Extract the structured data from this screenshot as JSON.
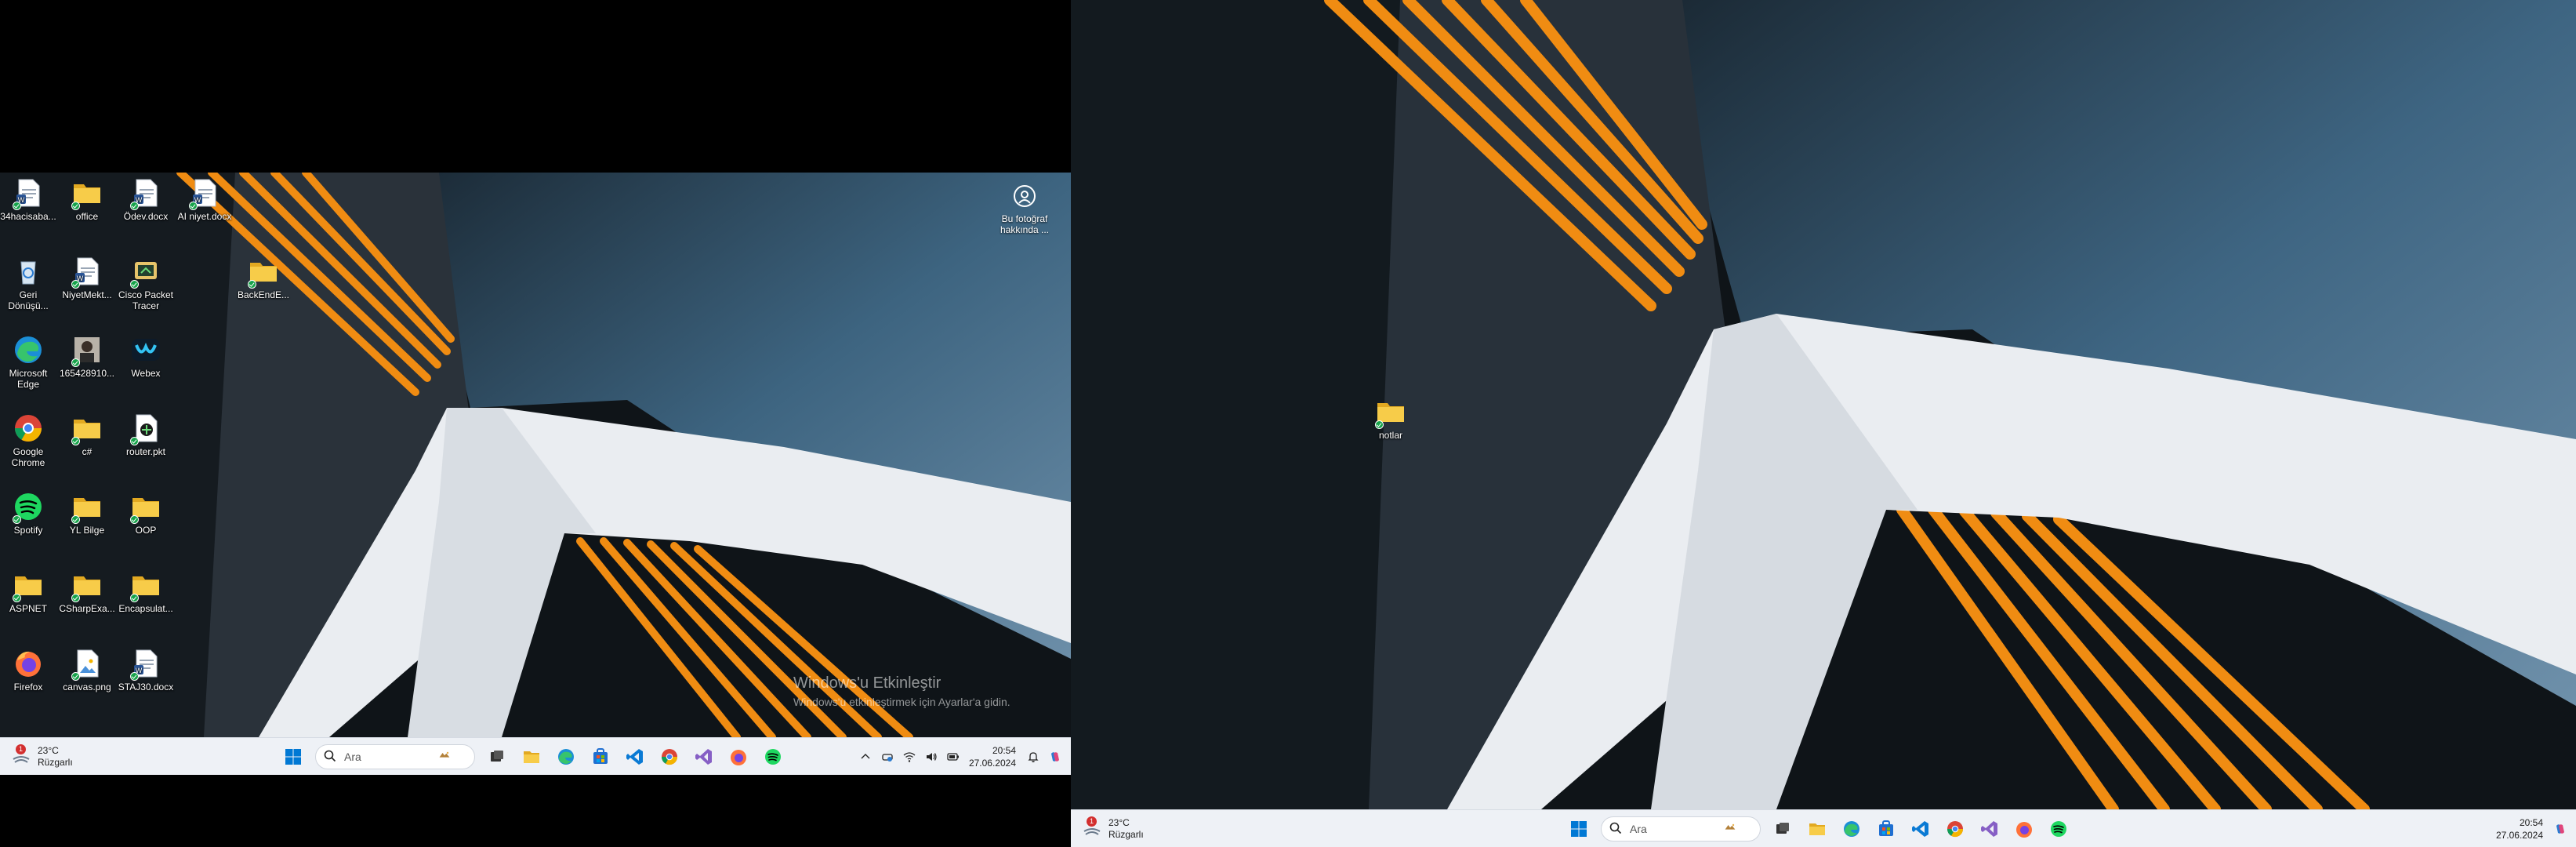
{
  "monitor1": {
    "desktop_icons": [
      {
        "label": "34hacisaba...",
        "type": "docfile",
        "sync": true
      },
      {
        "label": "office",
        "type": "folder",
        "sync": true
      },
      {
        "label": "Ödev.docx",
        "type": "docfile",
        "sync": true
      },
      {
        "label": "AI niyet.docx",
        "type": "docfile",
        "sync": true
      },
      {
        "label": "Geri Dönüşü...",
        "type": "recycle",
        "sync": false
      },
      {
        "label": "NiyetMekt...",
        "type": "docfile",
        "sync": true
      },
      {
        "label": "Cisco Packet Tracer",
        "type": "cisco",
        "sync": true
      },
      {
        "label": "BackEndE...",
        "type": "folder",
        "sync": true
      },
      {
        "label": "Microsoft Edge",
        "type": "edge",
        "sync": false
      },
      {
        "label": "165428910...",
        "type": "photo",
        "sync": true
      },
      {
        "label": "Webex",
        "type": "webex",
        "sync": false
      },
      {
        "label": "Google Chrome",
        "type": "chrome",
        "sync": false
      },
      {
        "label": "c#",
        "type": "folder",
        "sync": true
      },
      {
        "label": "router.pkt",
        "type": "pkt",
        "sync": true
      },
      {
        "label": "Spotify",
        "type": "spotify",
        "sync": true
      },
      {
        "label": "YL Bilge",
        "type": "folder",
        "sync": true
      },
      {
        "label": "OOP",
        "type": "folder",
        "sync": true
      },
      {
        "label": "ASPNET",
        "type": "folder",
        "sync": true
      },
      {
        "label": "CSharpExa...",
        "type": "folder",
        "sync": true
      },
      {
        "label": "Encapsulat...",
        "type": "folder",
        "sync": true
      },
      {
        "label": "Firefox",
        "type": "firefox",
        "sync": false
      },
      {
        "label": "canvas.png",
        "type": "image",
        "sync": true
      },
      {
        "label": "STAJ30.docx",
        "type": "docfile",
        "sync": true
      }
    ],
    "about_photo": {
      "label": "Bu fotoğraf hakkında ..."
    },
    "activation": {
      "title": "Windows'u Etkinleştir",
      "subtitle": "Windows'u etkinleştirmek için Ayarlar'a gidin."
    },
    "taskbar": {
      "weather": {
        "temp": "23°C",
        "desc": "Rüzgarlı",
        "badge": "1"
      },
      "search_placeholder": "Ara",
      "apps": [
        "windows-start",
        "task-view",
        "file-explorer",
        "edge",
        "store",
        "vscode",
        "chrome",
        "visual-studio",
        "firefox",
        "spotify"
      ],
      "tray": {
        "time": "20:54",
        "date": "27.06.2024"
      }
    }
  },
  "monitor2": {
    "desktop_icons": [
      {
        "label": "notlar",
        "type": "folder",
        "sync": true
      }
    ],
    "taskbar": {
      "weather": {
        "temp": "23°C",
        "desc": "Rüzgarlı",
        "badge": "1"
      },
      "search_placeholder": "Ara",
      "apps": [
        "windows-start",
        "task-view",
        "file-explorer",
        "edge",
        "store",
        "vscode",
        "chrome",
        "visual-studio",
        "firefox",
        "spotify"
      ],
      "tray": {
        "time": "20:54",
        "date": "27.06.2024"
      }
    }
  },
  "colors": {
    "taskbar_bg": "#eef1f6",
    "folder": "#f4c542",
    "orange_pipes": "#f0900f",
    "bridge_white": "#eef1f6",
    "sky_blue": "#3f6680"
  }
}
